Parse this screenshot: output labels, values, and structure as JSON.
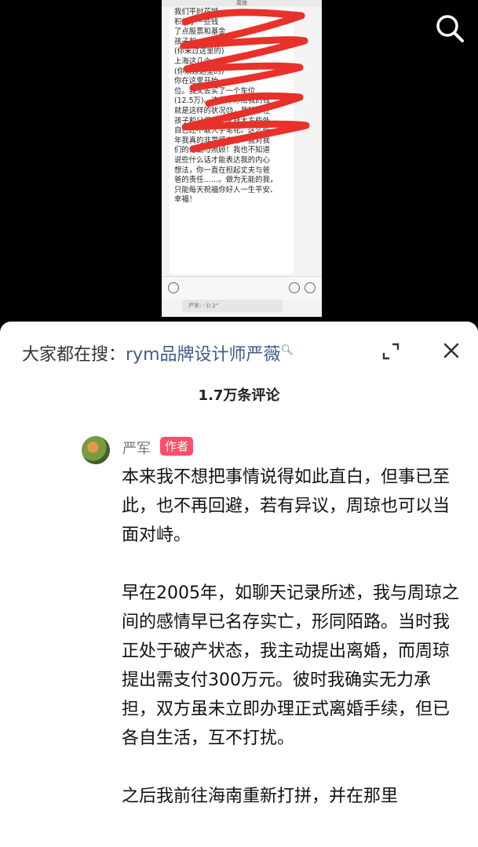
{
  "top": {
    "search_icon": "search-icon",
    "chat_screenshot": {
      "title": "周琼",
      "lines": "我们平时花销\n积攒了一些钱\n了点股票和基金\n孩子和\n(你来过这里的)\n上海这几个\n(你来过这里的)\n你在这里开始\n位。我又去买了一个车位\n(12.5万)。这些年你给我的钱\n就是这样的状况😓，我除了在\n孩子和父母身上花钱大方些外，\n自己还不敢大手笔花。这么些\n年我真的非常感谢你一直对我\n们的付出与照顾！我也不知道\n说些什么话才能表达我的内心\n想法，你一直在担起丈夫与爸\n爸的责任……。做为无能的我，\n只能每天祝福你好人一生平安、\n幸福！",
      "voice_label": "严军: ◦)) 2\""
    }
  },
  "sheet": {
    "hot_search_prefix": "大家都在搜：",
    "hot_search_keyword": "rym品牌设计师严薇",
    "hot_search_icon": "search-small-icon",
    "expand_icon": "expand-icon",
    "close_icon": "close-icon",
    "comment_count": "1.7万条评论",
    "comment": {
      "username": "严军",
      "badge": "作者",
      "paragraphs": [
        "本来我不想把事情说得如此直白，但事已至此，也不再回避，若有异议，周琼也可以当面对峙。",
        "早在2005年，如聊天记录所述，我与周琼之间的感情早已名存实亡，形同陌路。当时我正处于破产状态，我主动提出离婚，而周琼提出需支付300万元。彼时我确实无力承担，双方虽未立即办理正式离婚手续，但已各自生活，互不打扰。",
        "之后我前往海南重新打拼，并在那里"
      ]
    }
  }
}
